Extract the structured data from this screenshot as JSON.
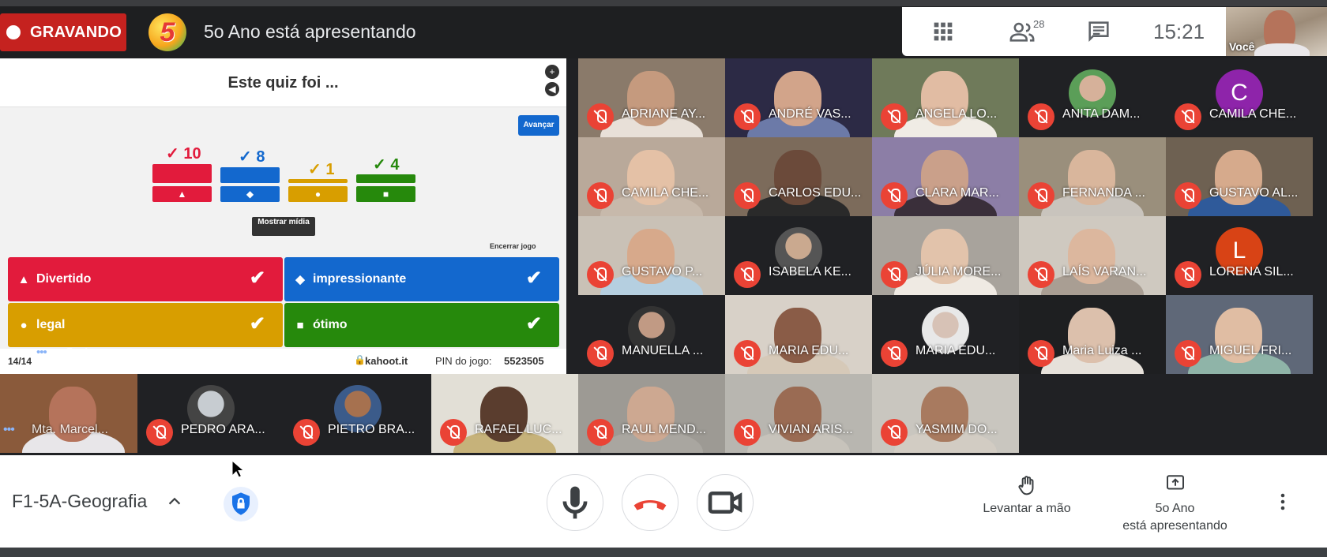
{
  "recording": {
    "label": "GRAVANDO"
  },
  "presenter": {
    "title": "5o Ano está apresentando",
    "avatar_glyph": "5",
    "tile_name": "5o Ano"
  },
  "top_controls": {
    "people_count": "28",
    "time": "15:21",
    "self_label": "Você"
  },
  "quiz": {
    "title": "Este quiz foi ...",
    "next_label": "Avançar",
    "show_media_label": "Mostrar mídia",
    "end_game_label": "Encerrar jogo",
    "results": [
      {
        "shape": "triangle",
        "count": "10",
        "color": "#e21b3c"
      },
      {
        "shape": "diamond",
        "count": "8",
        "color": "#1368ce"
      },
      {
        "shape": "circle",
        "count": "1",
        "color": "#d89e00"
      },
      {
        "shape": "square",
        "count": "4",
        "color": "#26890c"
      }
    ],
    "answers": [
      {
        "shape": "▲",
        "label": "Divertido"
      },
      {
        "shape": "◆",
        "label": "impressionante"
      },
      {
        "shape": "●",
        "label": "legal"
      },
      {
        "shape": "■",
        "label": "ótimo"
      }
    ],
    "question_count": "14/14",
    "url": "kahoot.it",
    "pin_label": "PIN do jogo:",
    "pin": "5523505"
  },
  "participants": [
    {
      "name": "ADRIANE AY...",
      "kind": "video",
      "bg": "#8a7a6a",
      "skin": "#c59a7e",
      "shirt": "#e8e0d8"
    },
    {
      "name": "ANDRÉ VAS...",
      "kind": "video",
      "bg": "#2c2a45",
      "skin": "#d2a48a",
      "shirt": "#6c7aa8"
    },
    {
      "name": "ANGELA LO...",
      "kind": "video",
      "bg": "#6f7a5a",
      "skin": "#e1bca3",
      "shirt": "#f0ece5"
    },
    {
      "name": "ANITA DAM...",
      "kind": "photo",
      "bg": "#202124",
      "skin": "#d6b19a",
      "shirt": "#5b9e58"
    },
    {
      "name": "CAMILA CHE...",
      "kind": "letter",
      "letter": "C",
      "bg": "#202124",
      "circle": "#8e24aa"
    },
    {
      "name": "CAMILA CHE...",
      "kind": "video",
      "bg": "#b9a99a",
      "skin": "#e4c1a6",
      "shirt": "#c7b9ab"
    },
    {
      "name": "CARLOS EDU...",
      "kind": "video",
      "bg": "#7c6b5b",
      "skin": "#6b4a3a",
      "shirt": "#2a2a2a"
    },
    {
      "name": "CLARA MAR...",
      "kind": "video",
      "bg": "#8c7ea6",
      "skin": "#caa08a",
      "shirt": "#3a2f3a"
    },
    {
      "name": "FERNANDA ...",
      "kind": "video",
      "bg": "#9a8f7c",
      "skin": "#d9b69c",
      "shirt": "#c9c4bd"
    },
    {
      "name": "GUSTAVO AL...",
      "kind": "video",
      "bg": "#6e6152",
      "skin": "#d6aa8c",
      "shirt": "#2f5a9a"
    },
    {
      "name": "GUSTAVO P...",
      "kind": "video",
      "bg": "#c9c1b6",
      "skin": "#d7a98b",
      "shirt": "#b5cfe0"
    },
    {
      "name": "ISABELA KE...",
      "kind": "photo",
      "bg": "#202124",
      "skin": "#caa98f",
      "shirt": "#555"
    },
    {
      "name": "JÚLIA MORE...",
      "kind": "video",
      "bg": "#a8a39c",
      "skin": "#e2c3ab",
      "shirt": "#efeae3"
    },
    {
      "name": "LAÍS VARAN...",
      "kind": "video",
      "bg": "#cfc9c0",
      "skin": "#dcb79e",
      "shirt": "#a99e93"
    },
    {
      "name": "LORENA SIL...",
      "kind": "letter",
      "letter": "L",
      "bg": "#202124",
      "circle": "#d84315"
    },
    {
      "name": "MANUELLA ...",
      "kind": "photo",
      "bg": "#202124",
      "skin": "#c19a84",
      "shirt": "#333"
    },
    {
      "name": "MARIA EDU...",
      "kind": "video",
      "bg": "#d8d1c8",
      "skin": "#8a5c47",
      "shirt": "#d6c9b8"
    },
    {
      "name": "MARIA EDU...",
      "kind": "photo",
      "bg": "#202124",
      "skin": "#d7c2b6",
      "shirt": "#e8e8e8"
    },
    {
      "name": "Maria Luiza ...",
      "kind": "video",
      "bg": "#1e1f21",
      "skin": "#dcc0ac",
      "shirt": "#e6e1da"
    },
    {
      "name": "MIGUEL FRI...",
      "kind": "video",
      "bg": "#5f6878",
      "skin": "#e0bda3",
      "shirt": "#8fb4a8"
    },
    {
      "name": "Mta. Marcel...",
      "kind": "video-host",
      "bg": "#8a5a3b",
      "skin": "#b5735b",
      "shirt": "#e8e6e9"
    },
    {
      "name": "PEDRO ARA...",
      "kind": "photo",
      "bg": "#202124",
      "skin": "#c7ccd1",
      "shirt": "#444"
    },
    {
      "name": "PIETRO BRA...",
      "kind": "photo",
      "bg": "#202124",
      "skin": "#a6714f",
      "shirt": "#3b5b8a"
    },
    {
      "name": "RAFAEL LUC...",
      "kind": "video",
      "bg": "#e2dfd6",
      "skin": "#5a3d2e",
      "shirt": "#c6b27a"
    },
    {
      "name": "RAUL MEND...",
      "kind": "video",
      "bg": "#9d9a94",
      "skin": "#cda891",
      "shirt": "#a9a6a0"
    },
    {
      "name": "VIVIAN ARIS...",
      "kind": "video",
      "bg": "#b8b6b0",
      "skin": "#9a6b53",
      "shirt": "#c7c3bb"
    },
    {
      "name": "YASMIM DO...",
      "kind": "video",
      "bg": "#c9c6bf",
      "skin": "#a87a5f",
      "shirt": "#d2ccc3"
    }
  ],
  "bottom": {
    "meeting_name": "F1-5A-Geografia",
    "raise_hand": "Levantar a mão",
    "present_line1": "5o Ano",
    "present_line2": "está apresentando"
  },
  "icons": {
    "grid": "grid-icon",
    "people": "people-icon",
    "chat": "chat-icon",
    "mic": "mic-icon",
    "hangup": "hangup-icon",
    "camera": "camera-icon",
    "hand": "raise-hand-icon",
    "present": "present-icon",
    "more": "more-vert-icon",
    "shield": "shield-icon",
    "chevron": "chevron-up-icon"
  },
  "colors": {
    "recording": "#c5221f",
    "mute": "#ea4335",
    "hangup": "#ea4335",
    "accent": "#1a73e8"
  }
}
